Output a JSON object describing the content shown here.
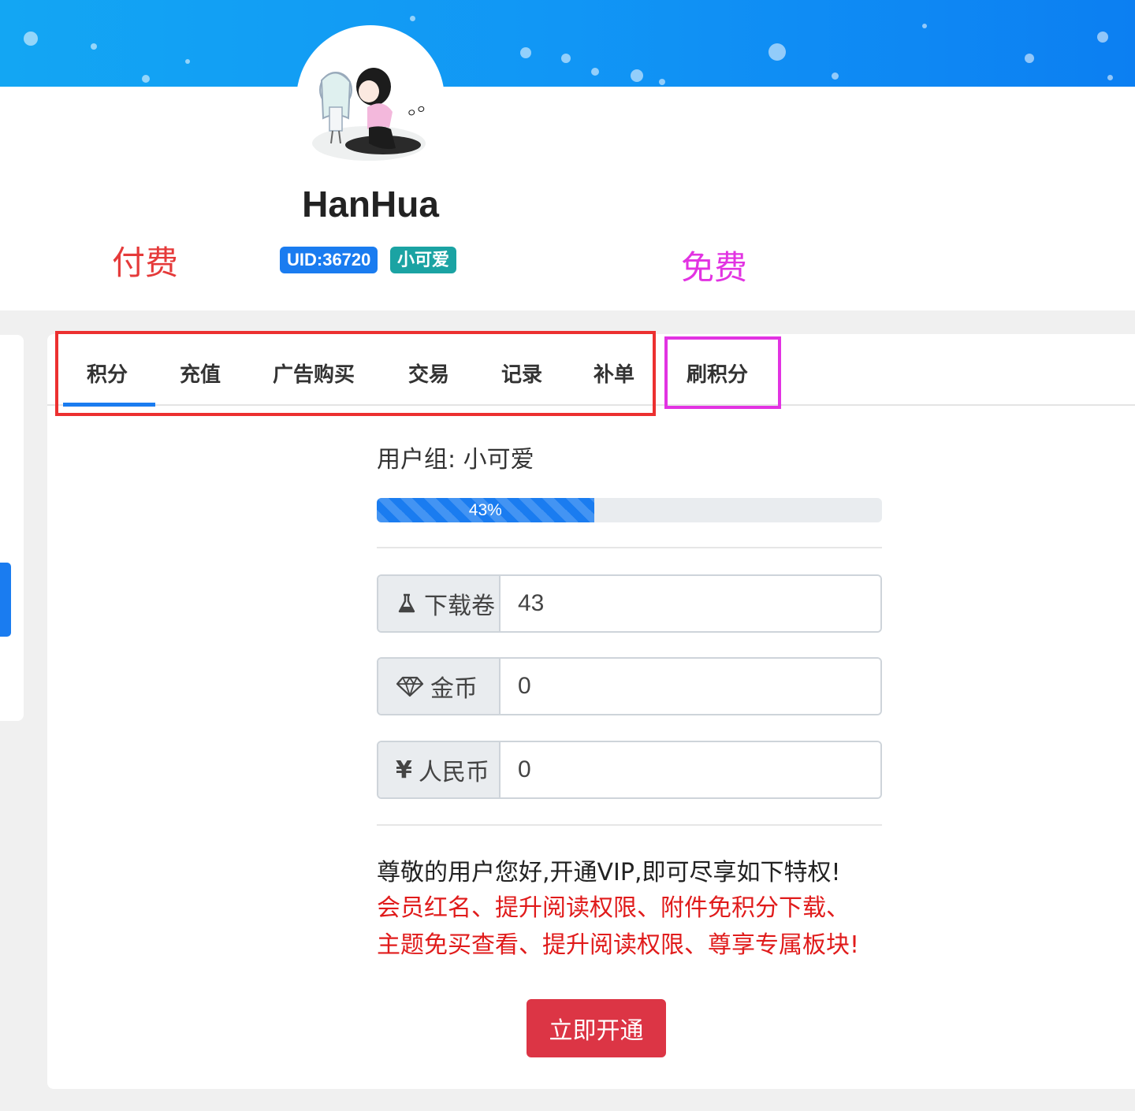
{
  "user": {
    "name": "HanHua",
    "uid_badge": "UID:36720",
    "group_badge": "小可爱"
  },
  "annotations": {
    "paid": "付费",
    "free": "免费"
  },
  "tabs": [
    {
      "label": "积分",
      "active": true
    },
    {
      "label": "充值"
    },
    {
      "label": "广告购买"
    },
    {
      "label": "交易"
    },
    {
      "label": "记录"
    },
    {
      "label": "补单"
    },
    {
      "label": "刷积分"
    }
  ],
  "profile": {
    "group_label": "用户组: 小可爱",
    "progress_percent": 43,
    "progress_text": "43%"
  },
  "fields": [
    {
      "icon": "flask-icon",
      "label": "下载卷",
      "value": "43"
    },
    {
      "icon": "diamond-icon",
      "label": "金币",
      "value": "0"
    },
    {
      "icon": "yen-icon",
      "label": "人民币",
      "value": "0"
    }
  ],
  "vip": {
    "intro": "尊敬的用户您好,开通VIP,即可尽享如下特权!",
    "perks": "会员红名、提升阅读权限、附件免积分下载、主题免买查看、提升阅读权限、尊享专属板块!",
    "button": "立即开通"
  },
  "colors": {
    "primary": "#1a7cf0",
    "danger": "#dc3545",
    "perk_text": "#e01b1b",
    "annotation_paid": "#e53a3a",
    "annotation_free": "#e233e2"
  }
}
